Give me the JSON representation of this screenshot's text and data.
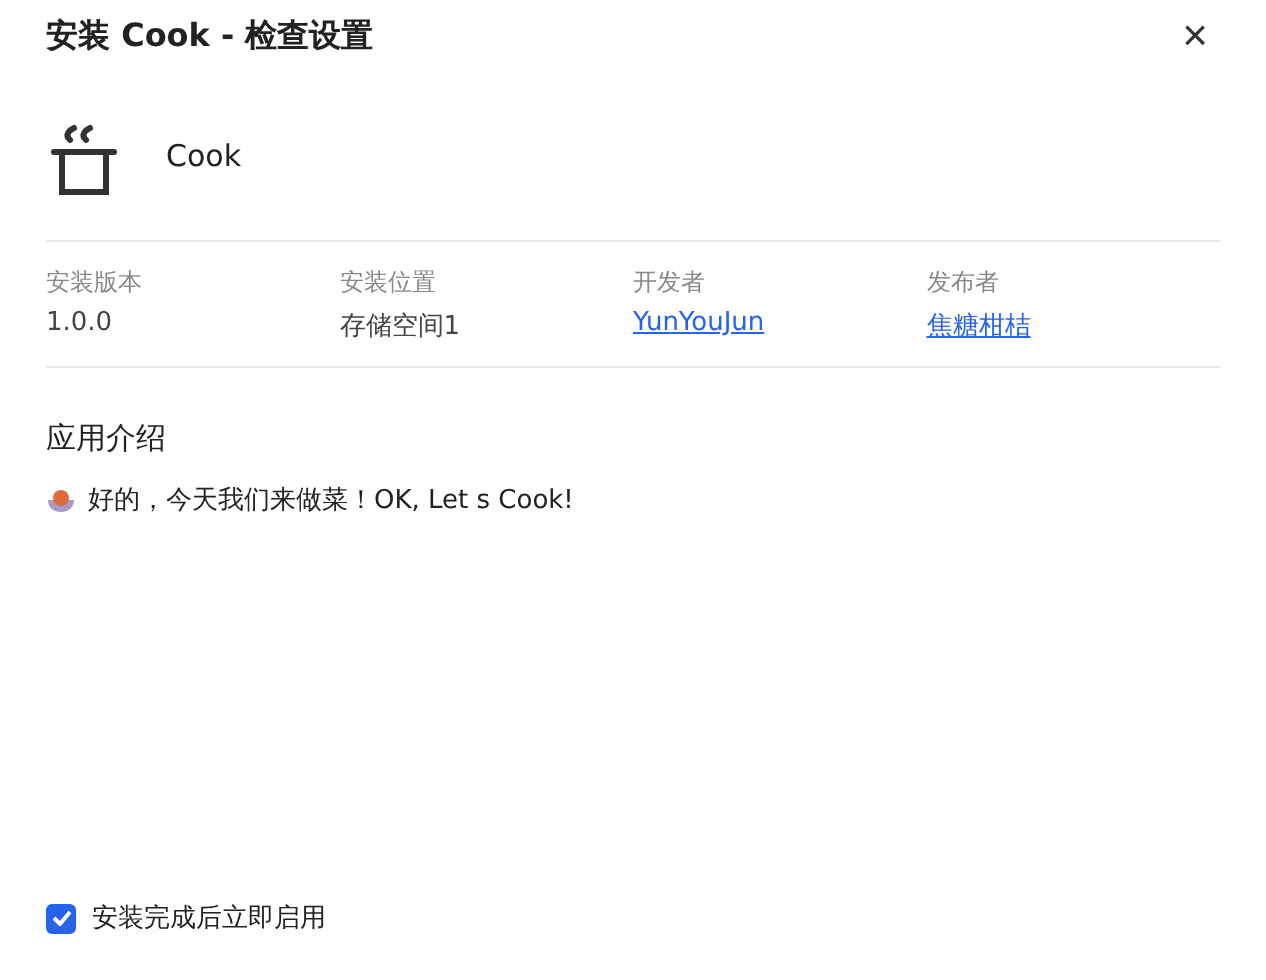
{
  "window": {
    "title": "安装 Cook - 检查设置",
    "close": "×"
  },
  "app": {
    "name": "Cook"
  },
  "info": [
    {
      "label": "安装版本",
      "value": "1.0.0",
      "kind": "text"
    },
    {
      "label": "安装位置",
      "value": "存储空间1",
      "kind": "text"
    },
    {
      "label": "开发者",
      "value": "YunYouJun",
      "kind": "link"
    },
    {
      "label": "发布者",
      "value": "焦糖柑桔",
      "kind": "link"
    }
  ],
  "description": {
    "heading": "应用介绍",
    "text": "好的，今天我们来做菜！OK, Let s Cook!"
  },
  "launch_option": {
    "label": "安装完成后立即启用",
    "checked": true
  }
}
